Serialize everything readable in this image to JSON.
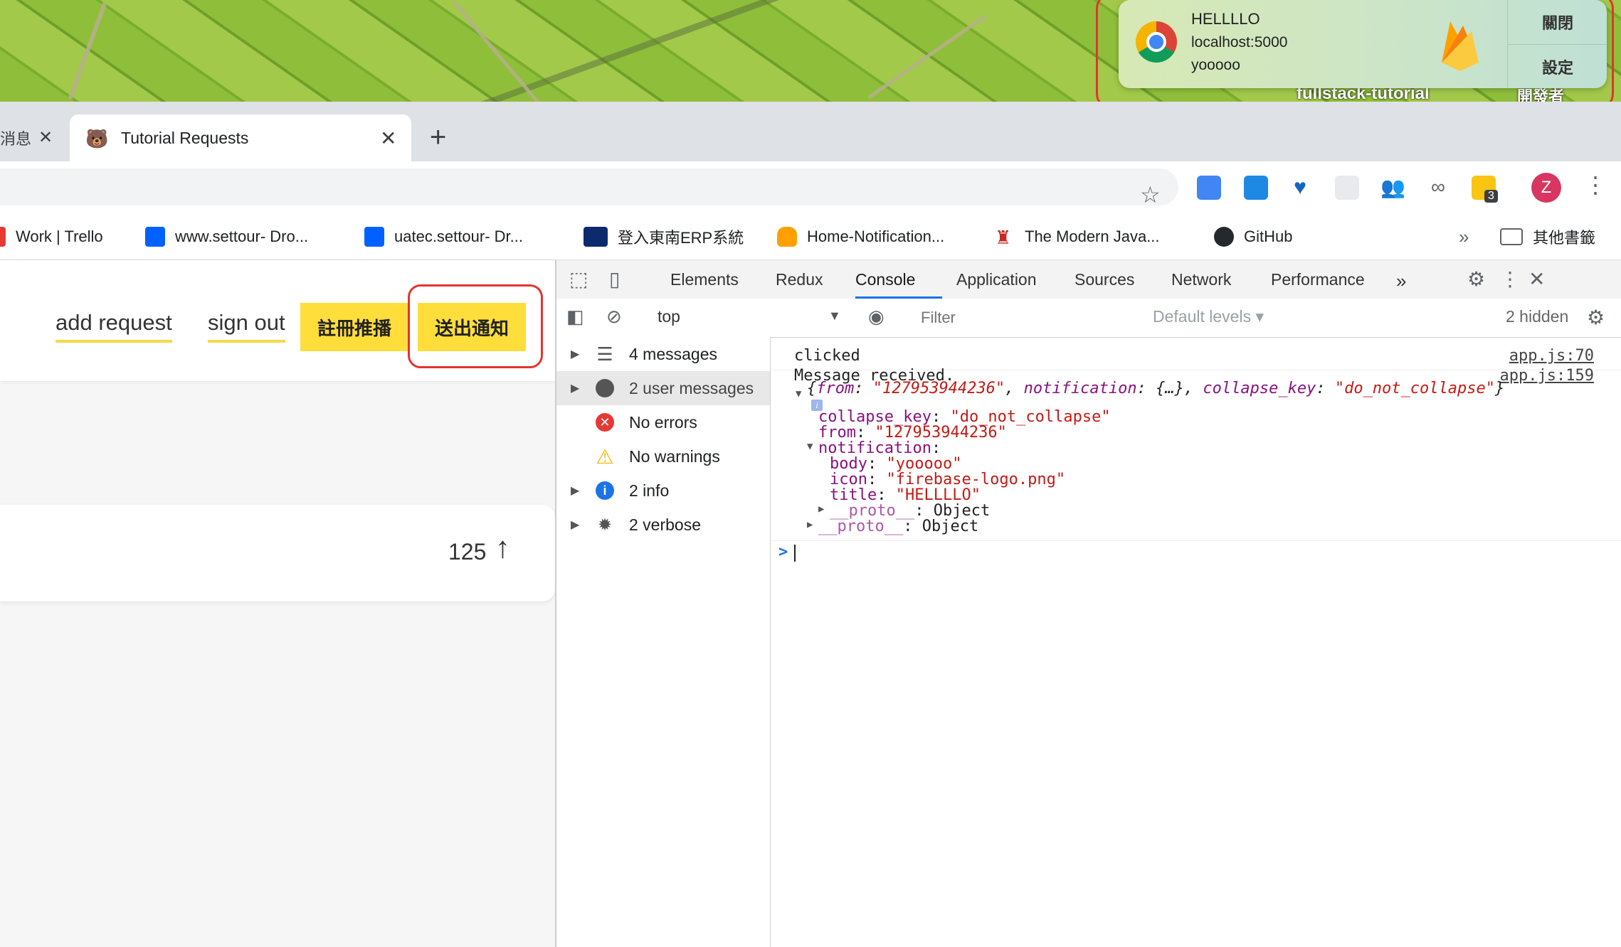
{
  "notification": {
    "title": "HELLLLO",
    "host": "localhost:5000",
    "body": "yooooo",
    "close_label": "關閉",
    "settings_label": "設定",
    "desktop_caption": "fullstack-tutorial",
    "desktop_caption_right": "開發者"
  },
  "tabs": {
    "prev_label": "消息",
    "active_title": "Tutorial Requests",
    "active_favicon": "🐻"
  },
  "toolbar": {
    "avatar_letter": "Z",
    "ext_badge": "3"
  },
  "bookmarks": {
    "items": [
      "Work | Trello",
      "www.settour- Dro...",
      "uatec.settour- Dr...",
      "登入東南ERP系統",
      "Home-Notification...",
      "The Modern Java...",
      "GitHub"
    ],
    "overflow": "»",
    "other": "其他書籤"
  },
  "page": {
    "add_request": "add request",
    "sign_out": "sign out",
    "register_push": "註冊推播",
    "send_notification": "送出通知",
    "upvotes": "125"
  },
  "devtools": {
    "tabs": [
      "Elements",
      "Redux",
      "Console",
      "Application",
      "Sources",
      "Network",
      "Performance"
    ],
    "more_tabs": "»",
    "context": "top",
    "filter_placeholder": "Filter",
    "levels": "Default levels ▾",
    "hidden": "2 hidden",
    "sidebar": [
      "4 messages",
      "2 user messages",
      "No errors",
      "No warnings",
      "2 info",
      "2 verbose"
    ],
    "console": {
      "line1": "clicked",
      "line1_src": "app.js:70",
      "line2": "Message received.",
      "line2_src": "app.js:159",
      "obj_open": "{",
      "from_key": "from",
      "from_val": "\"127953944236\"",
      "notif_key": "notification",
      "notif_summary": "{…}",
      "ck_key": "collapse_key",
      "ck_val": "\"do_not_collapse\"",
      "obj_close": "}",
      "body_key": "body",
      "body_val": "\"yooooo\"",
      "icon_key": "icon",
      "icon_val": "\"firebase-logo.png\"",
      "title_key": "title",
      "title_val": "\"HELLLLO\"",
      "proto_key": "__proto__",
      "proto_val": "Object",
      "prompt": ">"
    }
  },
  "colors": {
    "accent_yellow": "#ffde3b",
    "highlight_red": "#e3342f",
    "devtools_blue": "#1a73e8",
    "console_key": "#881280",
    "console_string": "#c41a16"
  }
}
